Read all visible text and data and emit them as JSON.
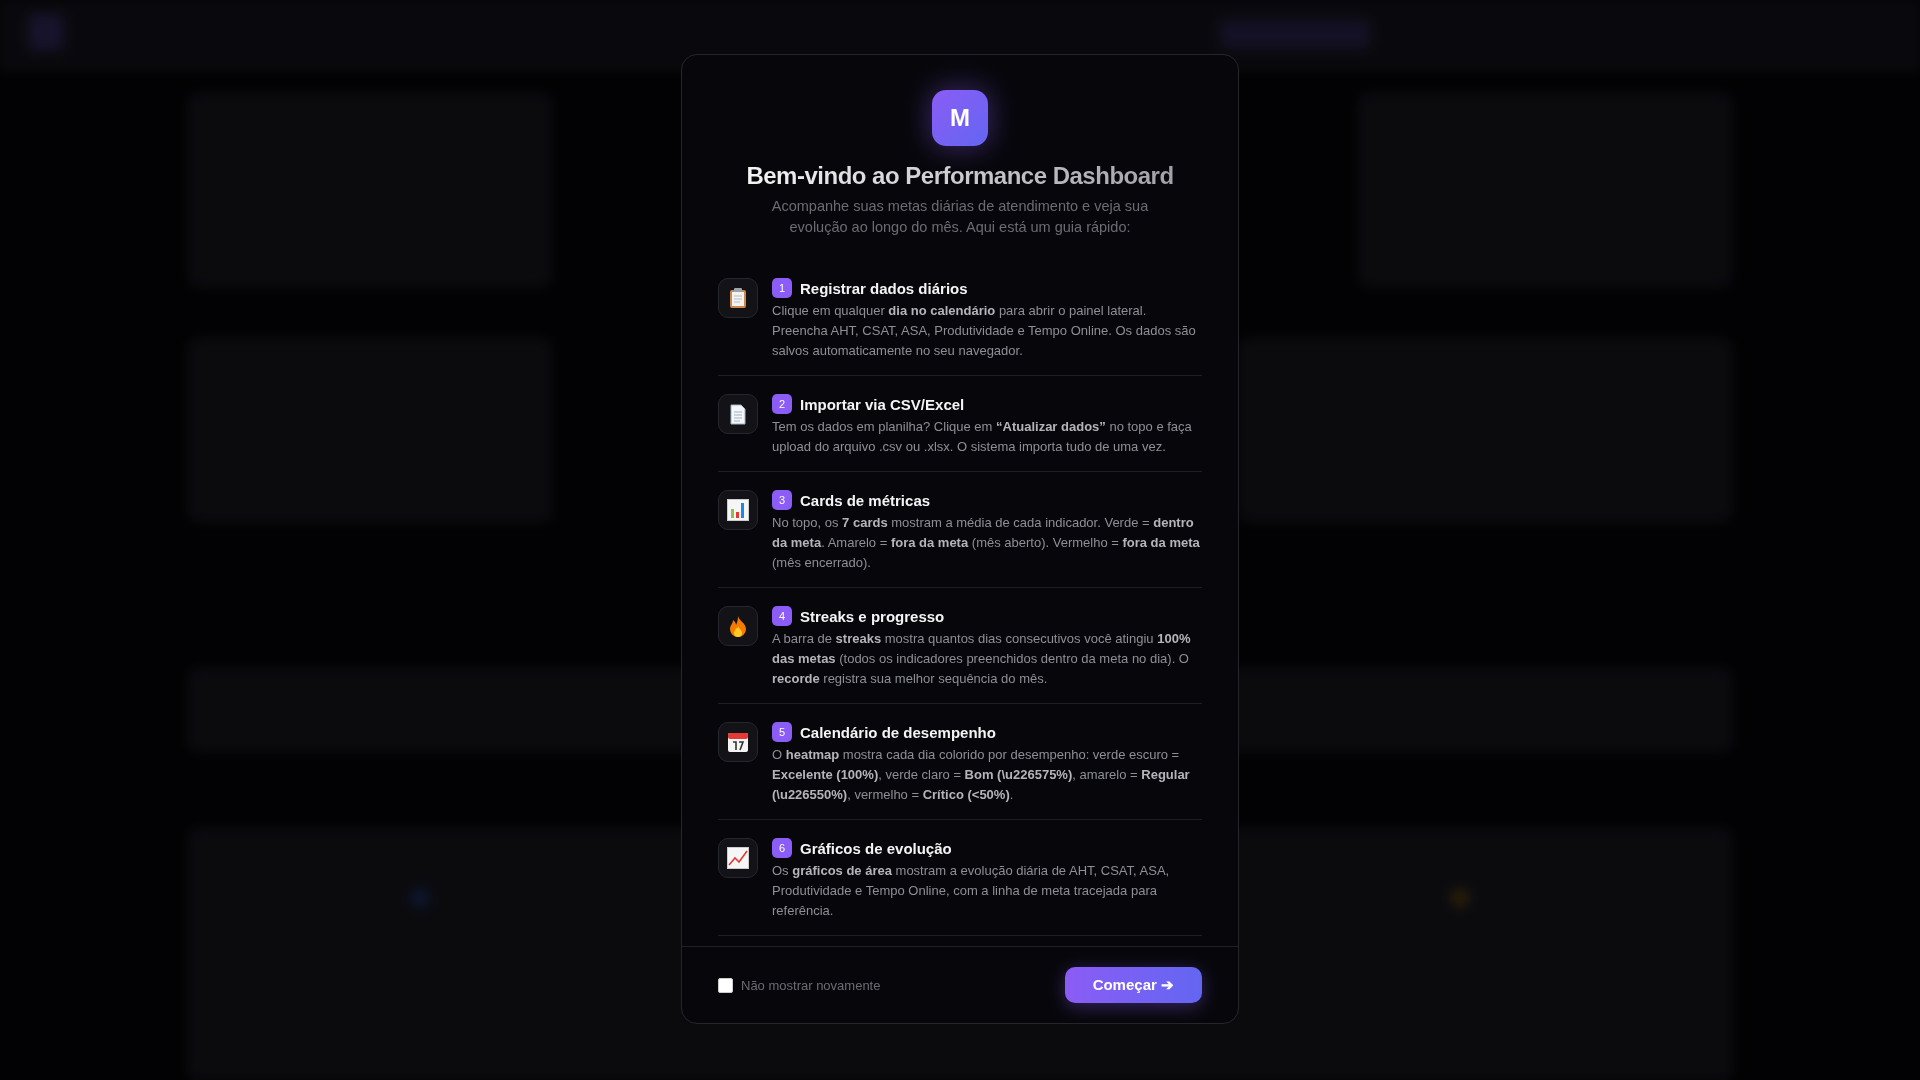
{
  "modal": {
    "logo": "M",
    "title": "Bem-vindo ao Performance Dashboard",
    "subtitle": "Acompanhe suas metas diárias de atendimento e veja sua evolução ao longo do mês. Aqui está um guia rápido:",
    "steps": [
      {
        "number": "1",
        "kind": "clipboard",
        "title": "Registrar dados diários",
        "text": "Clique em qualquer **dia no calendário** para abrir o painel lateral. Preencha AHT, CSAT, ASA, Produtividade e Tempo Online. Os dados são salvos automaticamente no seu navegador."
      },
      {
        "number": "2",
        "kind": "document",
        "title": "Importar via CSV/Excel",
        "text": "Tem os dados em planilha? Clique em **“Atualizar dados”** no topo e faça upload do arquivo .csv ou .xlsx. O sistema importa tudo de uma vez."
      },
      {
        "number": "3",
        "kind": "bars",
        "title": "Cards de métricas",
        "text": "No topo, os **7 cards** mostram a média de cada indicador. Verde = **dentro da meta**. Amarelo = **fora da meta** (mês aberto). Vermelho = **fora da meta** (mês encerrado)."
      },
      {
        "number": "4",
        "kind": "flame",
        "title": "Streaks e progresso",
        "text": "A barra de **streaks** mostra quantos dias consecutivos você atingiu **100% das metas** (todos os indicadores preenchidos dentro da meta no dia). O **recorde** registra sua melhor sequência do mês."
      },
      {
        "number": "5",
        "kind": "calendar",
        "title": "Calendário de desempenho",
        "text": "O **heatmap** mostra cada dia colorido por desempenho: verde escuro = **Excelente (100%)**, verde claro = **Bom (\\u226575%)**, amarelo = **Regular (\\u226550%)**, vermelho = **Crítico (<50%)**."
      },
      {
        "number": "6",
        "kind": "linechart",
        "title": "Gráficos de evolução",
        "text": "Os **gráficos de área** mostram a evolução diária de AHT, CSAT, ASA, Produtividade e Tempo Online, com a linha de meta tracejada para referência."
      }
    ],
    "dont_show_again": {
      "label": "Não mostrar novamente",
      "checked": false
    },
    "start_button": "Começar ➔"
  }
}
